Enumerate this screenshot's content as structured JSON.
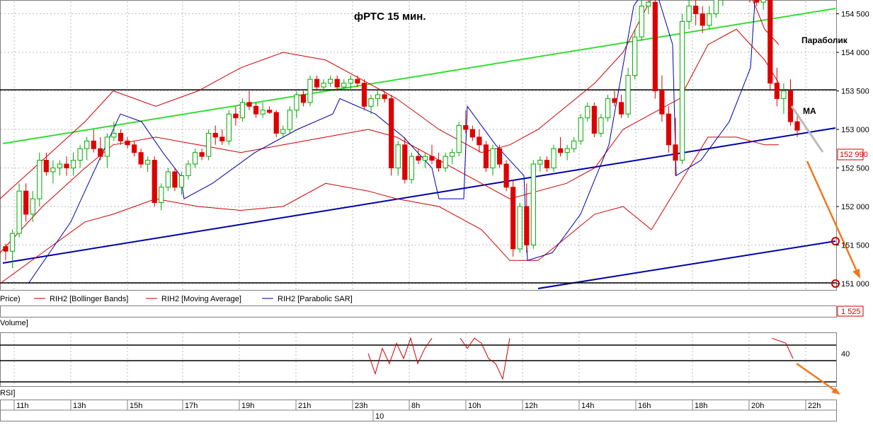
{
  "chart_data": {
    "type": "candlestick",
    "title": "фРТС   15 мин.",
    "annotations": {
      "parabolic": "Параболик",
      "ma": "MA"
    },
    "ylim": [
      151000,
      155200
    ],
    "y_ticks": [
      151000,
      151500,
      152000,
      152500,
      153000,
      153500,
      154000,
      154500,
      155000
    ],
    "y_tick_labels": [
      "151 000",
      "151 500",
      "152 000",
      "152 500",
      "153 000",
      "153 500",
      "154 000",
      "154 500",
      "155 000"
    ],
    "last_price_label": "152 990",
    "volume_value_label": "1 525",
    "rsi_tick_label": "40",
    "legend": [
      "Price)",
      "RIH2 [Bollinger Bands]",
      "RIH2 [Moving Average]",
      "RIH2 [Parabolic SAR]"
    ],
    "volume_panel_label": "Volume]",
    "rsi_panel_label": "RSI]",
    "time_labels": [
      "11h",
      "13h",
      "15h",
      "17h",
      "19h",
      "21h",
      "23h",
      "8h",
      "10h",
      "12h",
      "14h",
      "16h",
      "18h",
      "20h",
      "22h"
    ],
    "date_label": "10",
    "candles": [
      [
        151480,
        151520,
        151300,
        151420
      ],
      [
        151420,
        151700,
        151200,
        151650
      ],
      [
        151650,
        152300,
        151600,
        152200
      ],
      [
        152200,
        152300,
        151800,
        151900
      ],
      [
        151900,
        152200,
        151800,
        152100
      ],
      [
        152100,
        152700,
        152000,
        152600
      ],
      [
        152600,
        152700,
        152400,
        152450
      ],
      [
        152450,
        152600,
        152300,
        152500
      ],
      [
        152500,
        152600,
        152400,
        152550
      ],
      [
        152550,
        152650,
        152400,
        152500
      ],
      [
        152500,
        152700,
        152400,
        152600
      ],
      [
        152600,
        152800,
        152500,
        152750
      ],
      [
        152750,
        152900,
        152600,
        152850
      ],
      [
        152850,
        153000,
        152700,
        152750
      ],
      [
        152750,
        152900,
        152600,
        152650
      ],
      [
        152650,
        152950,
        152500,
        152900
      ],
      [
        152900,
        153100,
        152850,
        152950
      ],
      [
        152950,
        153000,
        152800,
        152850
      ],
      [
        152850,
        152900,
        152750,
        152800
      ],
      [
        152800,
        152850,
        152650,
        152700
      ],
      [
        152700,
        152750,
        152500,
        152550
      ],
      [
        152550,
        152650,
        152450,
        152600
      ],
      [
        152600,
        152650,
        152000,
        152050
      ],
      [
        152050,
        152300,
        151950,
        152250
      ],
      [
        152250,
        152500,
        152200,
        152450
      ],
      [
        152450,
        152500,
        152200,
        152250
      ],
      [
        152250,
        152450,
        152150,
        152400
      ],
      [
        152400,
        152600,
        152350,
        152550
      ],
      [
        152550,
        152750,
        152500,
        152700
      ],
      [
        152700,
        152750,
        152600,
        152650
      ],
      [
        152650,
        153000,
        152600,
        152950
      ],
      [
        152950,
        153050,
        152800,
        152900
      ],
      [
        152900,
        153000,
        152800,
        152850
      ],
      [
        152850,
        153250,
        152800,
        153200
      ],
      [
        153200,
        153300,
        153050,
        153150
      ],
      [
        153150,
        153400,
        153100,
        153350
      ],
      [
        153350,
        153500,
        153250,
        153300
      ],
      [
        153300,
        153350,
        153150,
        153200
      ],
      [
        153200,
        153350,
        153150,
        153250
      ],
      [
        153250,
        153300,
        153200,
        153220
      ],
      [
        153220,
        153250,
        152900,
        152950
      ],
      [
        152950,
        153050,
        152900,
        153000
      ],
      [
        153000,
        153300,
        152950,
        153250
      ],
      [
        153250,
        153500,
        153150,
        153450
      ],
      [
        153450,
        153500,
        153300,
        153350
      ],
      [
        153350,
        153700,
        153300,
        153650
      ],
      [
        153650,
        153700,
        153500,
        153550
      ],
      [
        153550,
        153650,
        153500,
        153600
      ],
      [
        153600,
        153700,
        153550,
        153650
      ],
      [
        153650,
        153700,
        153500,
        153550
      ],
      [
        153550,
        153650,
        153500,
        153600
      ],
      [
        153600,
        153700,
        153500,
        153650
      ],
      [
        153650,
        153700,
        153550,
        153600
      ],
      [
        153600,
        153650,
        153250,
        153300
      ],
      [
        153300,
        153450,
        153200,
        153400
      ],
      [
        153400,
        153500,
        153300,
        153450
      ],
      [
        153450,
        153500,
        153350,
        153400
      ],
      [
        153400,
        153450,
        152400,
        152500
      ],
      [
        152500,
        152850,
        152400,
        152800
      ],
      [
        152800,
        152900,
        152300,
        152350
      ],
      [
        152350,
        152700,
        152300,
        152650
      ],
      [
        152650,
        152750,
        152550,
        152600
      ],
      [
        152600,
        152700,
        152500,
        152650
      ],
      [
        152650,
        152800,
        152550,
        152600
      ],
      [
        152600,
        152700,
        152450,
        152500
      ],
      [
        152500,
        152700,
        152450,
        152650
      ],
      [
        152650,
        152750,
        152550,
        152700
      ],
      [
        152700,
        153100,
        152650,
        153050
      ],
      [
        153050,
        153250,
        152950,
        153000
      ],
      [
        153000,
        153050,
        152850,
        152900
      ],
      [
        152900,
        153000,
        152700,
        152800
      ],
      [
        152800,
        152850,
        152450,
        152500
      ],
      [
        152500,
        152800,
        152400,
        152750
      ],
      [
        152750,
        152800,
        152500,
        152550
      ],
      [
        152550,
        152600,
        152200,
        152250
      ],
      [
        152250,
        152350,
        151350,
        151450
      ],
      [
        151450,
        152050,
        151400,
        152000
      ],
      [
        152000,
        152300,
        151400,
        151500
      ],
      [
        151500,
        152600,
        151450,
        152550
      ],
      [
        152550,
        152650,
        152450,
        152600
      ],
      [
        152600,
        152650,
        152450,
        152500
      ],
      [
        152500,
        152800,
        152450,
        152750
      ],
      [
        152750,
        152900,
        152650,
        152700
      ],
      [
        152700,
        152800,
        152600,
        152750
      ],
      [
        152750,
        152900,
        152700,
        152850
      ],
      [
        152850,
        153200,
        152800,
        153150
      ],
      [
        153150,
        153350,
        153100,
        153300
      ],
      [
        153300,
        153350,
        152900,
        152950
      ],
      [
        152950,
        153200,
        152900,
        153150
      ],
      [
        153150,
        153450,
        153100,
        153400
      ],
      [
        153400,
        153500,
        153300,
        153350
      ],
      [
        153350,
        153450,
        153150,
        153200
      ],
      [
        153200,
        153800,
        153150,
        153700
      ],
      [
        153700,
        154300,
        153650,
        154200
      ],
      [
        154200,
        154700,
        154150,
        154600
      ],
      [
        154600,
        154700,
        154500,
        154650
      ],
      [
        154650,
        154700,
        153400,
        153500
      ],
      [
        153500,
        153700,
        153100,
        153200
      ],
      [
        153200,
        153300,
        152700,
        152800
      ],
      [
        152800,
        153150,
        152400,
        152600
      ],
      [
        152600,
        154500,
        152550,
        154400
      ],
      [
        154400,
        154700,
        154300,
        154600
      ],
      [
        154600,
        154800,
        154350,
        154500
      ],
      [
        154500,
        154600,
        154250,
        154350
      ],
      [
        154350,
        154600,
        154300,
        154500
      ],
      [
        154500,
        154750,
        154450,
        154700
      ],
      [
        154700,
        154900,
        154600,
        154850
      ],
      [
        154850,
        155100,
        154800,
        155050
      ],
      [
        155050,
        155200,
        154750,
        154800
      ],
      [
        154800,
        155000,
        154700,
        154950
      ],
      [
        154950,
        155100,
        154650,
        154700
      ],
      [
        154700,
        154800,
        154600,
        154650
      ],
      [
        154650,
        154750,
        154550,
        154700
      ],
      [
        154700,
        154750,
        153500,
        153600
      ],
      [
        153600,
        153800,
        153300,
        153400
      ],
      [
        153400,
        153600,
        153200,
        153500
      ],
      [
        153500,
        153650,
        153050,
        153100
      ],
      [
        153100,
        153200,
        152900,
        152990
      ]
    ],
    "bollinger_upper": [
      [
        0,
        152100
      ],
      [
        60,
        152600
      ],
      [
        120,
        153100
      ],
      [
        160,
        153500
      ],
      [
        220,
        153300
      ],
      [
        280,
        153500
      ],
      [
        340,
        153800
      ],
      [
        400,
        154000
      ],
      [
        460,
        153900
      ],
      [
        520,
        153600
      ],
      [
        560,
        153400
      ],
      [
        620,
        153000
      ],
      [
        680,
        152700
      ],
      [
        720,
        152800
      ],
      [
        760,
        153000
      ],
      [
        800,
        153300
      ],
      [
        840,
        153600
      ],
      [
        880,
        154000
      ],
      [
        920,
        154700
      ],
      [
        960,
        154900
      ],
      [
        1000,
        155100
      ],
      [
        1040,
        155200
      ],
      [
        1080,
        154300
      ],
      [
        1100,
        154100
      ]
    ],
    "bollinger_lower": [
      [
        0,
        151000
      ],
      [
        60,
        151400
      ],
      [
        120,
        151800
      ],
      [
        160,
        151900
      ],
      [
        220,
        152100
      ],
      [
        280,
        152000
      ],
      [
        340,
        151950
      ],
      [
        400,
        152000
      ],
      [
        460,
        152300
      ],
      [
        520,
        152200
      ],
      [
        560,
        152100
      ],
      [
        620,
        152000
      ],
      [
        680,
        151700
      ],
      [
        720,
        151300
      ],
      [
        760,
        151300
      ],
      [
        800,
        151600
      ],
      [
        840,
        151900
      ],
      [
        880,
        152000
      ],
      [
        920,
        151700
      ],
      [
        960,
        152300
      ],
      [
        1000,
        152900
      ],
      [
        1040,
        152900
      ],
      [
        1080,
        152800
      ],
      [
        1100,
        152800
      ]
    ],
    "moving_average": [
      [
        0,
        151400
      ],
      [
        60,
        152000
      ],
      [
        120,
        152500
      ],
      [
        160,
        152800
      ],
      [
        220,
        152900
      ],
      [
        280,
        152800
      ],
      [
        340,
        152700
      ],
      [
        400,
        152800
      ],
      [
        460,
        152900
      ],
      [
        520,
        153000
      ],
      [
        560,
        152900
      ],
      [
        620,
        152600
      ],
      [
        680,
        152300
      ],
      [
        720,
        152100
      ],
      [
        760,
        152200
      ],
      [
        800,
        152300
      ],
      [
        840,
        152500
      ],
      [
        880,
        153000
      ],
      [
        920,
        153200
      ],
      [
        960,
        153400
      ],
      [
        1000,
        154100
      ],
      [
        1040,
        154300
      ],
      [
        1080,
        153900
      ],
      [
        1100,
        153600
      ]
    ],
    "parabolic_sar": [
      [
        40,
        151000
      ],
      [
        100,
        151800
      ],
      [
        140,
        152600
      ],
      [
        170,
        153200
      ],
      [
        200,
        153100
      ],
      [
        230,
        152700
      ],
      [
        255,
        152400
      ],
      [
        260,
        152100
      ],
      [
        300,
        152300
      ],
      [
        360,
        152700
      ],
      [
        420,
        153000
      ],
      [
        470,
        153200
      ],
      [
        480,
        153400
      ],
      [
        530,
        153200
      ],
      [
        570,
        152900
      ],
      [
        610,
        152500
      ],
      [
        620,
        152100
      ],
      [
        655,
        152100
      ],
      [
        660,
        153300
      ],
      [
        700,
        152800
      ],
      [
        740,
        152400
      ],
      [
        745,
        151300
      ],
      [
        780,
        151400
      ],
      [
        820,
        151900
      ],
      [
        860,
        152800
      ],
      [
        895,
        154600
      ],
      [
        910,
        154800
      ],
      [
        930,
        154700
      ],
      [
        950,
        154100
      ],
      [
        955,
        152400
      ],
      [
        990,
        152600
      ],
      [
        1030,
        153100
      ],
      [
        1060,
        153800
      ],
      [
        1070,
        155200
      ],
      [
        1100,
        155000
      ],
      [
        1125,
        154750
      ]
    ],
    "rsi": [
      [
        520,
        0.4
      ],
      [
        530,
        0.8
      ],
      [
        540,
        0.3
      ],
      [
        550,
        0.6
      ],
      [
        560,
        0.2
      ],
      [
        570,
        0.5
      ],
      [
        580,
        0.1
      ],
      [
        590,
        0.6
      ],
      [
        600,
        0.3
      ],
      [
        610,
        0.1
      ],
      [
        650,
        0.1
      ],
      [
        660,
        0.3
      ],
      [
        670,
        0.1
      ],
      [
        680,
        0.2
      ],
      [
        690,
        0.5
      ],
      [
        700,
        0.6
      ],
      [
        710,
        0.9
      ],
      [
        720,
        0.1
      ],
      [
        1090,
        0.1
      ],
      [
        1110,
        0.2
      ],
      [
        1120,
        0.5
      ]
    ]
  }
}
